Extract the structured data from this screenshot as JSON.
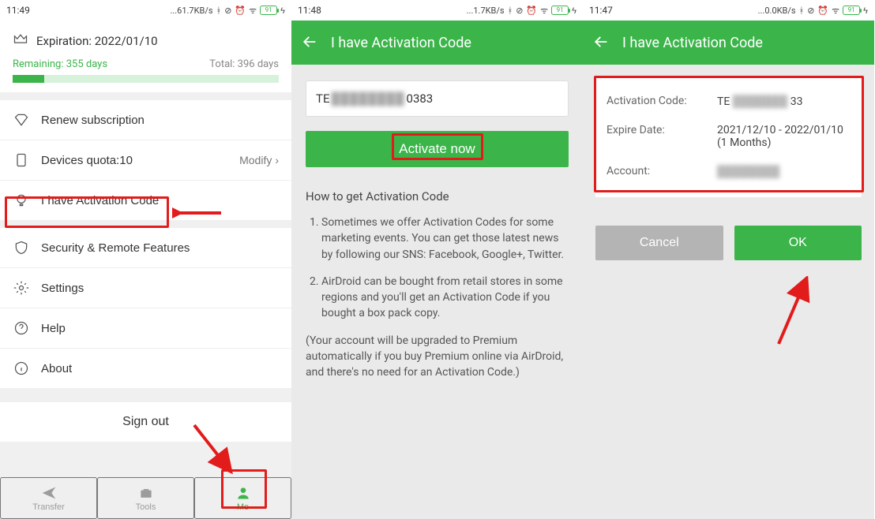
{
  "screen1": {
    "status": {
      "time": "11:49",
      "net": "...61.7KB/s",
      "battery": "91"
    },
    "expiration": {
      "label": "Expiration: 2022/01/10",
      "remaining": "Remaining: 355 days",
      "total": "Total: 396 days"
    },
    "rows": {
      "renew": "Renew subscription",
      "quota": "Devices quota:10",
      "quota_modify": "Modify",
      "activation": "I have Activation Code",
      "security": "Security & Remote Features",
      "settings": "Settings",
      "help": "Help",
      "about": "About"
    },
    "signout": "Sign out",
    "nav": {
      "transfer": "Transfer",
      "tools": "Tools",
      "me": "Me"
    }
  },
  "screen2": {
    "status": {
      "time": "11:48",
      "net": "...1.7KB/s",
      "battery": "91"
    },
    "title": "I have Activation Code",
    "code_prefix": "TE",
    "code_suffix": "0383",
    "activate": "Activate now",
    "howto_title": "How to get Activation Code",
    "howto_1": "Sometimes we offer Activation Codes for some marketing events. You can get those latest news by following our SNS: Facebook, Google+, Twitter.",
    "howto_2": "AirDroid can be bought from retail stores in some regions and you'll get an Activation Code if you bought a box pack copy.",
    "howto_note": "(Your account will be upgraded to Premium automatically if you buy Premium online via AirDroid, and there's no need for an Activation Code.)"
  },
  "screen3": {
    "status": {
      "time": "11:47",
      "net": "...0.0KB/s",
      "battery": "91"
    },
    "title": "I have Activation Code",
    "labels": {
      "code": "Activation Code:",
      "expire": "Expire Date:",
      "account": "Account:"
    },
    "values": {
      "code_prefix": "TE",
      "code_suffix": "33",
      "expire": "2021/12/10 - 2022/01/10 (1 Months)"
    },
    "cancel": "Cancel",
    "ok": "OK"
  }
}
